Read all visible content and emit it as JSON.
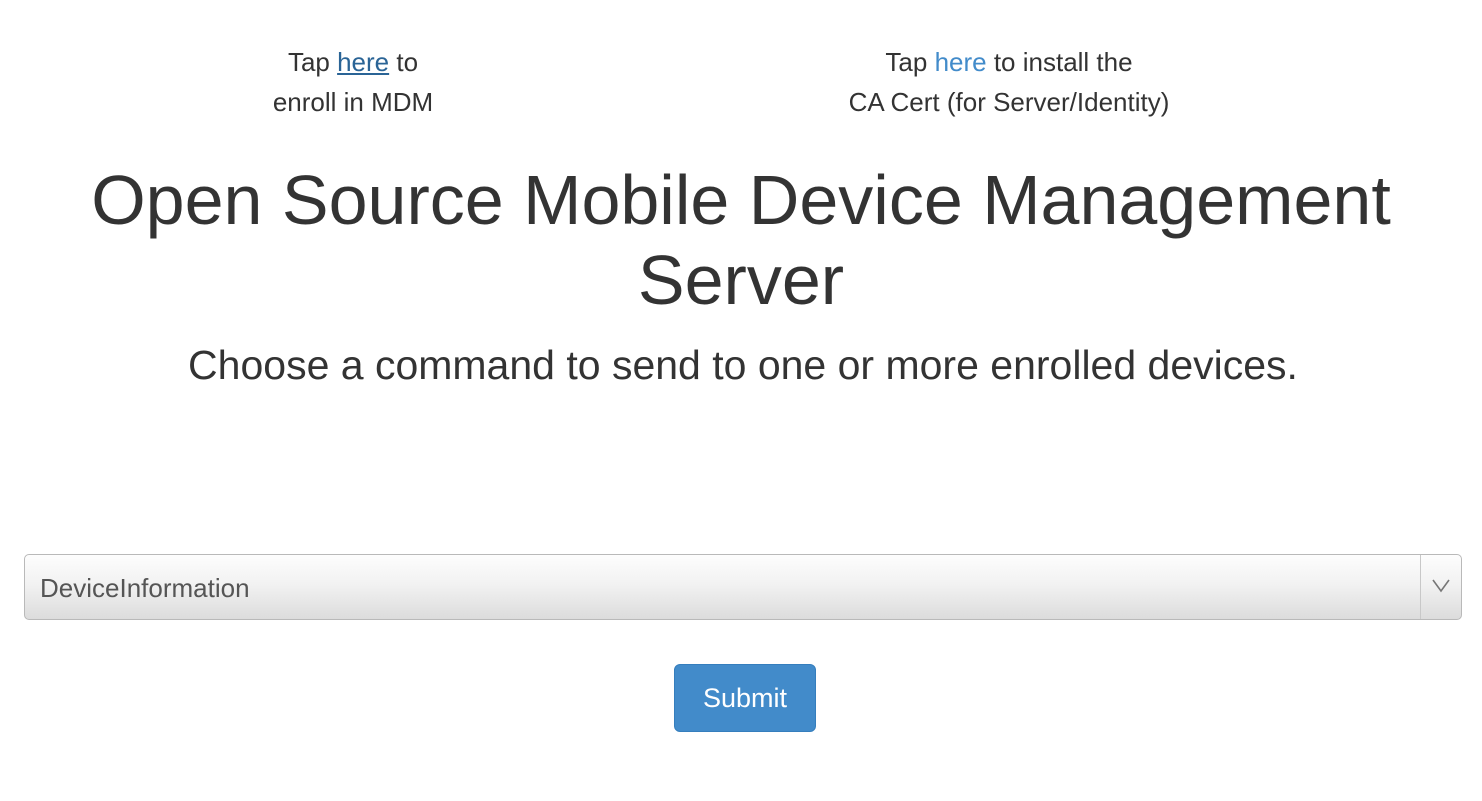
{
  "enroll": {
    "prefix": "Tap ",
    "link_text": "here",
    "suffix_line1": " to",
    "line2": "enroll in MDM"
  },
  "ca_cert": {
    "prefix": "Tap ",
    "link_text": "here",
    "suffix_line1": " to install the",
    "line2": "CA Cert (for Server/Identity)"
  },
  "header": {
    "title": "Open Source Mobile Device Management Server",
    "subtitle": "Choose a command to send to one or more enrolled devices."
  },
  "command_select": {
    "selected_value": "DeviceInformation"
  },
  "form": {
    "submit_label": "Submit"
  },
  "colors": {
    "link_visited": "#2a6496",
    "link": "#428bca",
    "primary_button": "#428bca",
    "text": "#333333"
  }
}
